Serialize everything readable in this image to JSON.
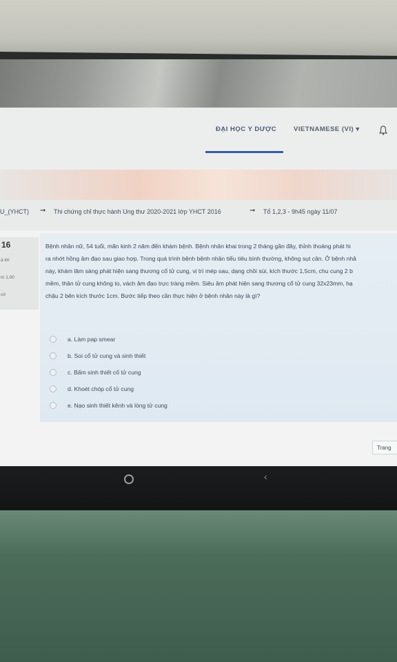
{
  "header": {
    "university_link": "ĐẠI HỌC Y DƯỢC",
    "language": "VIETNAMESE (VI)",
    "language_caret": "▾"
  },
  "breadcrumb": {
    "items": [
      "U_(YHCT)",
      "Thi chứng chỉ thực hành Ung thư 2020-2021 lớp YHCT 2016",
      "Tổ 1,2,3 - 9h45 ngày 11/07"
    ],
    "separator": "➞"
  },
  "question_info": {
    "number": "16",
    "status": "ả lời",
    "points": "m 1,00",
    "flag": "cờ"
  },
  "question": {
    "text_lines": [
      "Bệnh nhân nữ, 54 tuổi, mãn kinh 2 năm đến khám bệnh. Bệnh nhân khai trong 2 tháng gần đây, thỉnh thoảng phát hi",
      "ra nhớt hồng âm đạo sau giao hợp. Trong quá trình bệnh bệnh nhân tiểu tiêu bình thường, không sụt cân. Ở bệnh nhâ",
      "này, khám lâm sàng phát hiện sang thương cổ tử cung, vị trí mép sau, dạng chồi sùi, kích thước 1,5cm, chu cung 2 b",
      "mềm, thân tử cung không to, vách âm đạo trực tràng mềm. Siêu âm phát hiện sang thương cổ tử cung 32x23mm, hạ",
      "chậu 2 bên kích thước 1cm. Bước tiếp theo cần thực hiện ở bệnh nhân này là gì?"
    ],
    "options": [
      "a. Làm pap smear",
      "b. Soi cổ tử cung và sinh thiết",
      "c. Bấm sinh thiết cổ tử cung",
      "d. Khoét chóp cổ tử cung",
      "e. Nạo sinh thiết kênh và lòng tử cung"
    ]
  },
  "navigation": {
    "next_label": "Trang"
  }
}
